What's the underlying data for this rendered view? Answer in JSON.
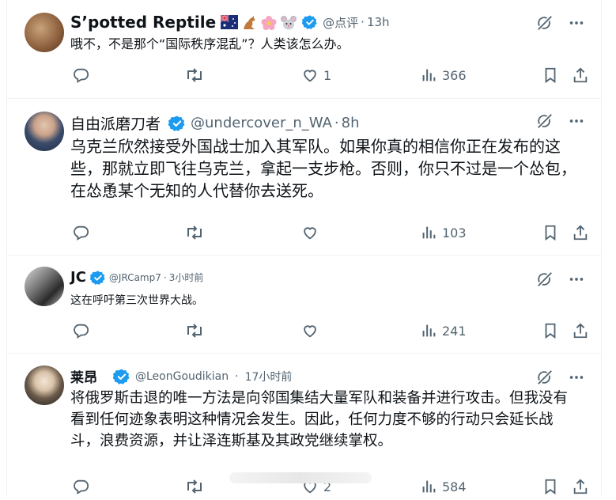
{
  "tweets": [
    {
      "name": "S’potted Reptile",
      "handle": "@点评",
      "time": "13h",
      "text": "哦不，不是那个“国际秩序混乱”？人类该怎么办。",
      "reply": "",
      "repost": "",
      "like": "1",
      "views": "366",
      "emoji": [
        "australia-flag-icon",
        "kangaroo-icon",
        "cherry-blossom-icon",
        "mouse-icon"
      ]
    },
    {
      "name": "自由派磨刀者",
      "handle": "@undercover_n_WA",
      "time": "8h",
      "text": "乌克兰欣然接受外国战士加入其军队。如果你真的相信你正在发布的这些，那就立即飞往乌克兰，拿起一支步枪。否则，你只不过是一个怂包，在怂恿某个无知的人代替你去送死。",
      "reply": "",
      "repost": "",
      "like": "",
      "views": "103"
    },
    {
      "name": "JC",
      "handle": "@JRCamp7",
      "time": "3小时前",
      "text": "这在呼吁第三次世界大战。",
      "reply": "",
      "repost": "",
      "like": "",
      "views": "241"
    },
    {
      "name": "莱昂",
      "handle": "@LeonGoudikian",
      "time": "17小时前",
      "text": "将俄罗斯击退的唯一方法是向邻国集结大量军队和装备并进行攻击。但我没有看到任何迹象表明这种情况会发生。因此，任何力度不够的行动只会延长战斗，浪费资源，并让泽连斯基及其政党继续掌权。",
      "reply": "",
      "repost": "",
      "like": "2",
      "views": "584"
    }
  ],
  "sep": "·",
  "colors": {
    "text": "#0f1419",
    "muted": "#536471",
    "verified": "#1d9bf0",
    "border": "#eff3f4"
  }
}
